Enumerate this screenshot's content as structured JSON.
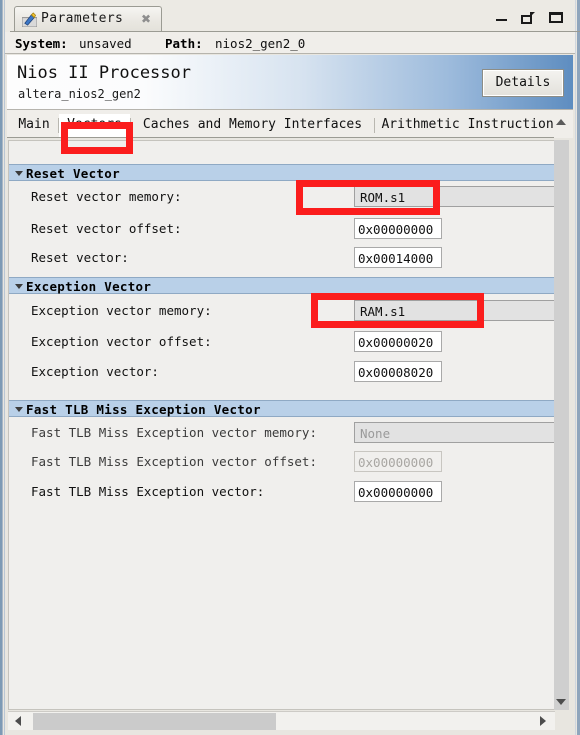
{
  "window": {
    "tab_title": "Parameters",
    "tab_icon": "wand-icon",
    "close_icon": "close-icon",
    "minimize_icon": "minimize-icon",
    "restore_icon": "restore-icon",
    "maximize_icon": "maximize-icon"
  },
  "status": {
    "system_key": "System:",
    "system_value": "unsaved",
    "path_key": "Path:",
    "path_value": "nios2_gen2_0"
  },
  "header": {
    "title": "Nios II Processor",
    "subtitle": "altera_nios2_gen2",
    "details_button": "Details"
  },
  "tabs": [
    {
      "label": "Main",
      "selected": false
    },
    {
      "label": "Vectors",
      "selected": true
    },
    {
      "label": "Caches and Memory Interfaces",
      "selected": false
    },
    {
      "label": "Arithmetic Instructions",
      "selected": false
    }
  ],
  "groups": [
    {
      "title": "Reset Vector",
      "rows": [
        {
          "label": "Reset vector memory:",
          "value": "ROM.s1",
          "kind": "combo",
          "disabled": false
        },
        {
          "label": "Reset vector offset:",
          "value": "0x00000000",
          "kind": "text",
          "disabled": false
        },
        {
          "label": "Reset vector:",
          "value": "0x00014000",
          "kind": "text",
          "disabled": false
        }
      ]
    },
    {
      "title": "Exception Vector",
      "rows": [
        {
          "label": "Exception vector memory:",
          "value": "RAM.s1",
          "kind": "combo",
          "disabled": false
        },
        {
          "label": "Exception vector offset:",
          "value": "0x00000020",
          "kind": "text",
          "disabled": false
        },
        {
          "label": "Exception vector:",
          "value": "0x00008020",
          "kind": "text",
          "disabled": false
        }
      ]
    },
    {
      "title": "Fast TLB Miss Exception Vector",
      "rows": [
        {
          "label": "Fast TLB Miss Exception vector memory:",
          "value": "None",
          "kind": "combo",
          "disabled": true
        },
        {
          "label": "Fast TLB Miss Exception vector offset:",
          "value": "0x00000000",
          "kind": "text",
          "disabled": true
        },
        {
          "label": "Fast TLB Miss Exception vector:",
          "value": "0x00000000",
          "kind": "text",
          "disabled": false
        }
      ]
    }
  ],
  "annotations": {
    "color": "#fb1d1d",
    "boxes": [
      "tab-vectors",
      "reset-vector-memory",
      "exception-vector-memory"
    ]
  },
  "scrollbars": {
    "vertical_up_icon": "chevron-up-icon",
    "vertical_down_icon": "chevron-down-icon",
    "horizontal_left_icon": "chevron-left-icon",
    "horizontal_right_icon": "chevron-right-icon"
  }
}
